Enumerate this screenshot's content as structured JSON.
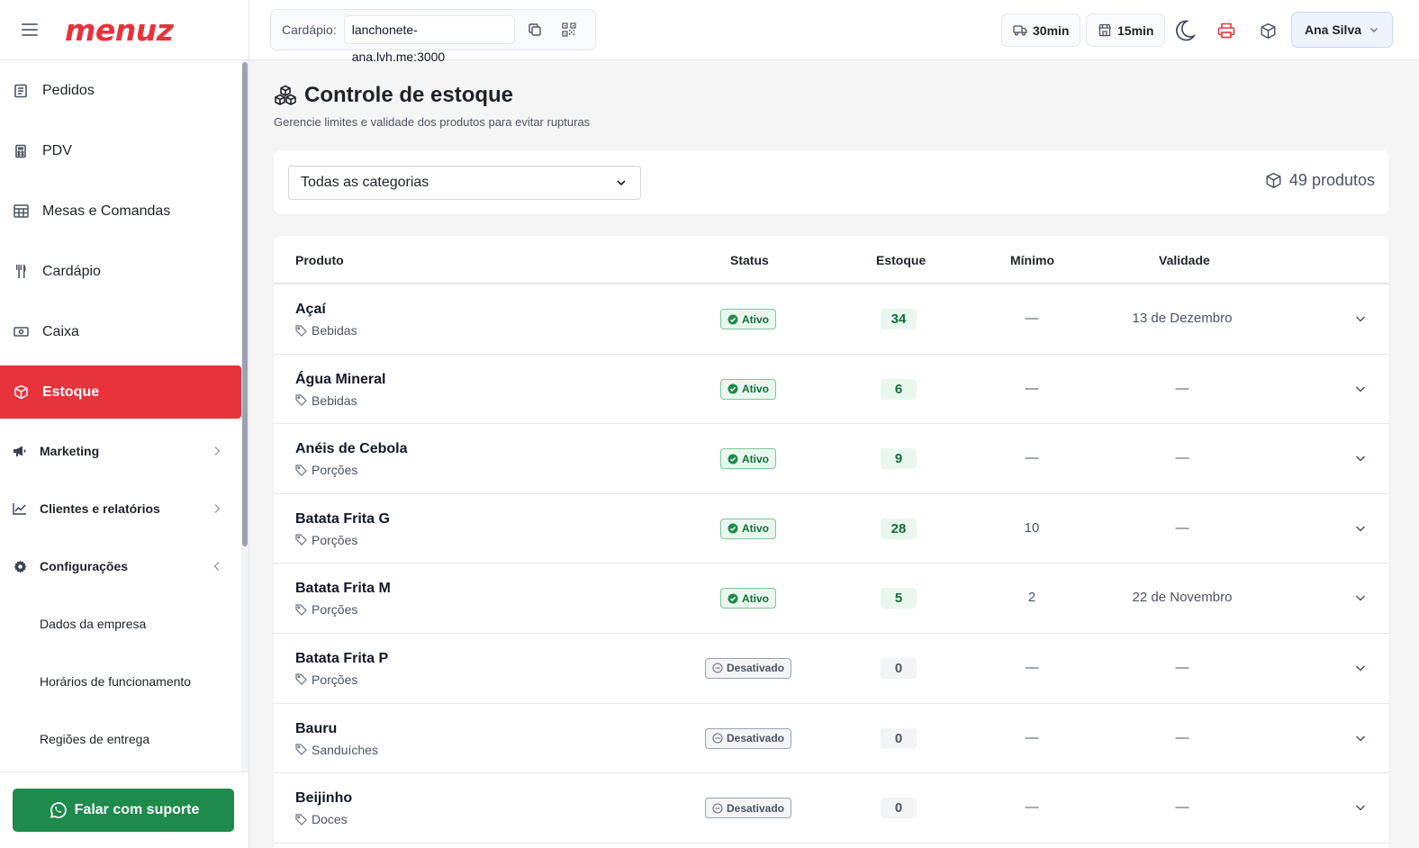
{
  "brand": {
    "logo_text": "menuz",
    "accent": "#e8323c"
  },
  "sidebar": {
    "items": [
      {
        "label": "Pedidos",
        "icon": "receipt-icon"
      },
      {
        "label": "PDV",
        "icon": "calculator-icon"
      },
      {
        "label": "Mesas e Comandas",
        "icon": "table-grid-icon"
      },
      {
        "label": "Cardápio",
        "icon": "utensils-icon"
      },
      {
        "label": "Caixa",
        "icon": "cash-icon"
      },
      {
        "label": "Estoque",
        "icon": "box-icon",
        "active": true
      }
    ],
    "groups": [
      {
        "label": "Marketing",
        "icon": "megaphone-icon",
        "expanded": false
      },
      {
        "label": "Clientes e relatórios",
        "icon": "chart-line-icon",
        "expanded": false
      },
      {
        "label": "Configurações",
        "icon": "gear-icon",
        "expanded": true
      }
    ],
    "sub_items": [
      "Dados da empresa",
      "Horários de funcionamento",
      "Regiões de entrega"
    ],
    "support_label": "Falar com suporte",
    "support_color": "#1e8a4c"
  },
  "topbar": {
    "menu_label": "Cardápio:",
    "menu_url": "lanchonete-ana.lvh.me:3000",
    "delivery_time": "30min",
    "pickup_time": "15min",
    "user_name": "Ana Silva"
  },
  "page": {
    "title": "Controle de estoque",
    "subtitle": "Gerencie limites e validade dos produtos para evitar rupturas",
    "category_filter": "Todas as categorias",
    "product_count": "49 produtos"
  },
  "table": {
    "headers": {
      "product": "Produto",
      "status": "Status",
      "stock": "Estoque",
      "minimum": "Mínimo",
      "expiry": "Validade"
    },
    "rows": [
      {
        "name": "Açaí",
        "category": "Bebidas",
        "status": "Ativo",
        "active": true,
        "stock": "34",
        "minimum": "—",
        "expiry": "13 de Dezembro"
      },
      {
        "name": "Água Mineral",
        "category": "Bebidas",
        "status": "Ativo",
        "active": true,
        "stock": "6",
        "minimum": "—",
        "expiry": "—"
      },
      {
        "name": "Anéis de Cebola",
        "category": "Porções",
        "status": "Ativo",
        "active": true,
        "stock": "9",
        "minimum": "—",
        "expiry": "—"
      },
      {
        "name": "Batata Frita G",
        "category": "Porções",
        "status": "Ativo",
        "active": true,
        "stock": "28",
        "minimum": "10",
        "expiry": "—"
      },
      {
        "name": "Batata Frita M",
        "category": "Porções",
        "status": "Ativo",
        "active": true,
        "stock": "5",
        "minimum": "2",
        "expiry": "22 de Novembro"
      },
      {
        "name": "Batata Frita P",
        "category": "Porções",
        "status": "Desativado",
        "active": false,
        "stock": "0",
        "minimum": "—",
        "expiry": "—"
      },
      {
        "name": "Bauru",
        "category": "Sanduíches",
        "status": "Desativado",
        "active": false,
        "stock": "0",
        "minimum": "—",
        "expiry": "—"
      },
      {
        "name": "Beijinho",
        "category": "Doces",
        "status": "Desativado",
        "active": false,
        "stock": "0",
        "minimum": "—",
        "expiry": "—"
      }
    ]
  }
}
